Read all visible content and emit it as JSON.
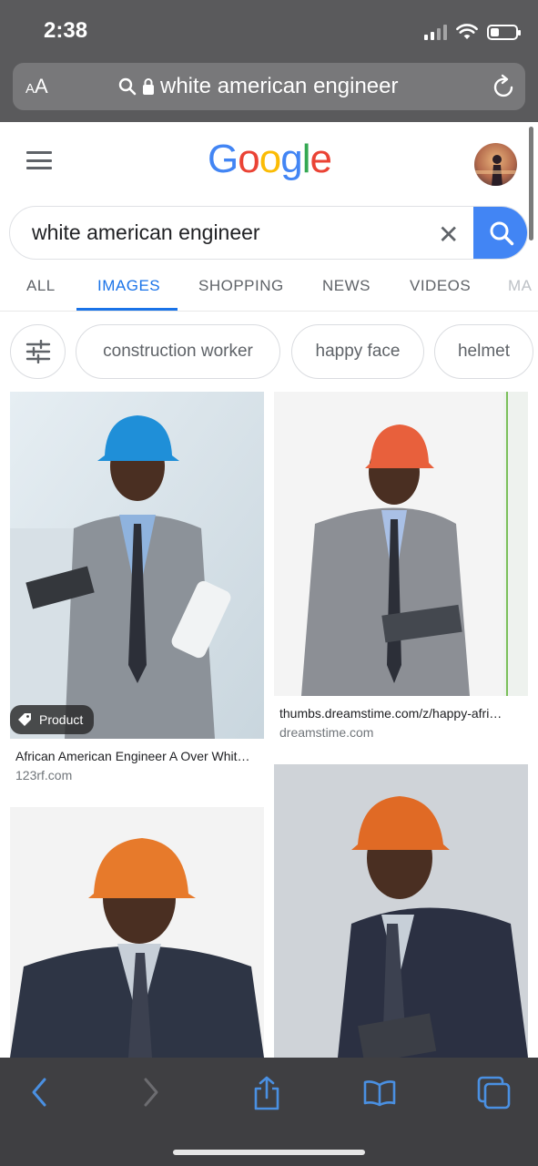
{
  "status": {
    "time": "2:38"
  },
  "safari": {
    "aa_small": "A",
    "aa_large": "A",
    "url_text": "white american engineer"
  },
  "google": {
    "logo_letters": [
      {
        "ch": "G",
        "color": "#4285F4"
      },
      {
        "ch": "o",
        "color": "#EA4335"
      },
      {
        "ch": "o",
        "color": "#FBBC05"
      },
      {
        "ch": "g",
        "color": "#4285F4"
      },
      {
        "ch": "l",
        "color": "#34A853"
      },
      {
        "ch": "e",
        "color": "#EA4335"
      }
    ],
    "search_value": "white american engineer",
    "clear_symbol": "✕"
  },
  "tabs": [
    {
      "label": "ALL",
      "active": false
    },
    {
      "label": "IMAGES",
      "active": true
    },
    {
      "label": "SHOPPING",
      "active": false
    },
    {
      "label": "NEWS",
      "active": false
    },
    {
      "label": "VIDEOS",
      "active": false
    },
    {
      "label": "MA",
      "active": false
    }
  ],
  "chips": [
    "construction worker",
    "happy face",
    "helmet"
  ],
  "results": [
    {
      "badge": "Product",
      "title": "African American Engineer A Over Whit…",
      "source": "123rf.com",
      "helmet_color": "#1f8fd8"
    },
    {
      "title": "thumbs.dreamstime.com/z/happy-afri…",
      "source": "dreamstime.com",
      "helmet_color": "#e8603c"
    },
    {
      "helmet_color": "#e77a2b"
    },
    {
      "helmet_color": "#e06a25"
    }
  ],
  "colors": {
    "accent": "#1a73e8",
    "search_button": "#4285f4",
    "safari_bar": "#5a5a5c",
    "safari_toolbar": "#3f3f42",
    "toolbar_icon": "#4a90e2"
  }
}
